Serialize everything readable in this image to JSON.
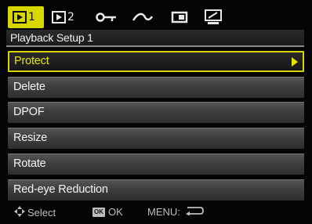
{
  "tabs": [
    {
      "icon": "playback-icon",
      "number": "1",
      "active": true
    },
    {
      "icon": "playback-icon",
      "number": "2",
      "active": false
    },
    {
      "icon": "key-icon",
      "active": false
    },
    {
      "icon": "wave-icon",
      "active": false
    },
    {
      "icon": "memory-card-icon",
      "active": false
    },
    {
      "icon": "monitor-icon",
      "active": false
    }
  ],
  "menu": {
    "title": "Playback Setup 1",
    "items": [
      {
        "label": "Protect",
        "selected": true
      },
      {
        "label": "Delete",
        "selected": false
      },
      {
        "label": "DPOF",
        "selected": false
      },
      {
        "label": "Resize",
        "selected": false
      },
      {
        "label": "Rotate",
        "selected": false
      },
      {
        "label": "Red-eye Reduction",
        "selected": false
      }
    ]
  },
  "footer": {
    "select_label": "Select",
    "ok_badge": "OK",
    "ok_label": "OK",
    "menu_label": "MENU:"
  },
  "colors": {
    "accent": "#d8d800",
    "background": "#050505",
    "item": "#3e3e3e"
  }
}
